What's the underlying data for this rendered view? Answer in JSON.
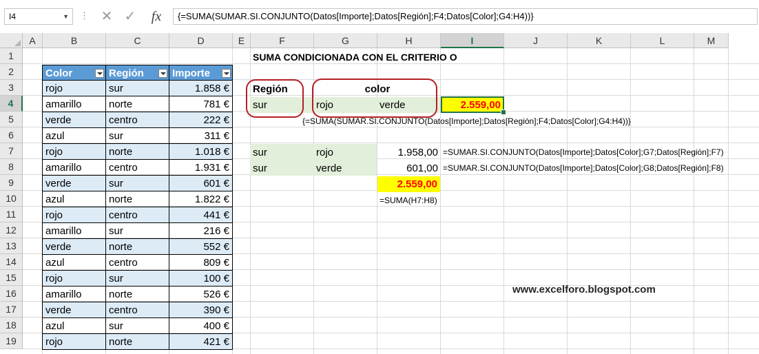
{
  "formula_bar": {
    "name_box": "I4",
    "formula": "{=SUMA(SUMAR.SI.CONJUNTO(Datos[Importe];Datos[Región];F4;Datos[Color];G4:H4))}"
  },
  "columns": [
    "A",
    "B",
    "C",
    "D",
    "E",
    "F",
    "G",
    "H",
    "I",
    "J",
    "K",
    "L",
    "M"
  ],
  "rows": [
    "1",
    "2",
    "3",
    "4",
    "5",
    "6",
    "7",
    "8",
    "9",
    "10",
    "11",
    "12",
    "13",
    "14",
    "15",
    "16",
    "17",
    "18",
    "19"
  ],
  "table": {
    "headers": [
      "Color",
      "Región",
      "Importe"
    ],
    "rows": [
      [
        "rojo",
        "sur",
        "1.858 €"
      ],
      [
        "amarillo",
        "norte",
        "781 €"
      ],
      [
        "verde",
        "centro",
        "222 €"
      ],
      [
        "azul",
        "sur",
        "311 €"
      ],
      [
        "rojo",
        "norte",
        "1.018 €"
      ],
      [
        "amarillo",
        "centro",
        "1.931 €"
      ],
      [
        "verde",
        "sur",
        "601 €"
      ],
      [
        "azul",
        "norte",
        "1.822 €"
      ],
      [
        "rojo",
        "centro",
        "441 €"
      ],
      [
        "amarillo",
        "sur",
        "216 €"
      ],
      [
        "verde",
        "norte",
        "552 €"
      ],
      [
        "azul",
        "centro",
        "809 €"
      ],
      [
        "rojo",
        "sur",
        "100 €"
      ],
      [
        "amarillo",
        "norte",
        "526 €"
      ],
      [
        "verde",
        "centro",
        "390 €"
      ],
      [
        "azul",
        "sur",
        "400 €"
      ],
      [
        "rojo",
        "norte",
        "421 €"
      ]
    ]
  },
  "analysis": {
    "title": "SUMA CONDICIONADA CON EL CRITERIO O",
    "region_label": "Región",
    "color_label": "color",
    "region_value": "sur",
    "color_value_1": "rojo",
    "color_value_2": "verde",
    "result": "2.559,00",
    "result_formula": "{=SUMA(SUMAR.SI.CONJUNTO(Datos[Importe];Datos[Región];F4;Datos[Color];G4:H4))}",
    "row7": {
      "region": "sur",
      "color": "rojo",
      "value": "1.958,00",
      "formula": "=SUMAR.SI.CONJUNTO(Datos[Importe];Datos[Color];G7;Datos[Región];F7)"
    },
    "row8": {
      "region": "sur",
      "color": "verde",
      "value": "601,00",
      "formula": "=SUMAR.SI.CONJUNTO(Datos[Importe];Datos[Color];G8;Datos[Región];F8)"
    },
    "sum": "2.559,00",
    "sum_formula": "=SUMA(H7:H8)"
  },
  "url": "www.excelforo.blogspot.com",
  "colors": {
    "table_header": "#5b9bd5",
    "table_band": "#ddebf7",
    "criteria_fill": "#e2efda",
    "highlight": "#ffff00",
    "result_text": "#ff0000",
    "ring": "#b41f24",
    "selection": "#217346"
  }
}
